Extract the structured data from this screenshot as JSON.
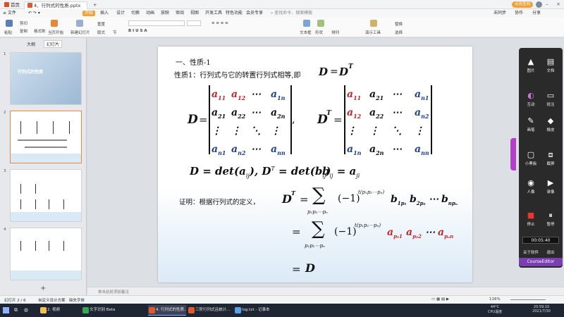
{
  "titlebar": {
    "tabs": [
      {
        "label": "首页",
        "icon": "home-icon"
      },
      {
        "label": "4、行列式的性质.pptx",
        "icon": "pptx-file-icon"
      }
    ],
    "add_tab": "+",
    "right_badge": "点亮签到"
  },
  "menubar": {
    "file": "≡ 文件",
    "items": [
      "开始",
      "插入",
      "设计",
      "切换",
      "动画",
      "放映",
      "审阅",
      "视图",
      "开发工具",
      "特色功能",
      "会员专享"
    ],
    "search_placeholder": "查找命令、搜索模板",
    "right": [
      "未同步",
      "协作",
      "分享"
    ]
  },
  "ribbon": {
    "groups": [
      "粘贴",
      "剪切",
      "复制",
      "格式刷",
      "当页开始",
      "新建幻灯片",
      "版式",
      "重置",
      "节",
      "文本框",
      "形状",
      "排列",
      "演示工具",
      "替换",
      "选择"
    ]
  },
  "leftpanel": {
    "tabs": [
      "大纲",
      "幻灯片"
    ],
    "slides": [
      {
        "num": "1",
        "title": "行列式的性质"
      },
      {
        "num": "2",
        "title": ""
      },
      {
        "num": "3",
        "title": ""
      },
      {
        "num": "4",
        "title": ""
      }
    ],
    "add": "+"
  },
  "slide": {
    "heading": "一、性质-1",
    "property_text": "性质1：行列式与它的转置行列式相等,即",
    "eq1_lhs": "D",
    "eq1_eq": "=",
    "eq1_rhs": "D",
    "eq1_sup": "T",
    "matrixD": {
      "label": "D",
      "eq": "=",
      "rows": [
        [
          {
            "b": "a",
            "s": "11",
            "c": "red"
          },
          {
            "b": "a",
            "s": "12",
            "c": "red"
          },
          {
            "b": "⋯",
            "s": "",
            "c": "blk"
          },
          {
            "b": "a",
            "s": "1n",
            "c": "blue"
          }
        ],
        [
          {
            "b": "a",
            "s": "21",
            "c": "blk"
          },
          {
            "b": "a",
            "s": "22",
            "c": "blk"
          },
          {
            "b": "⋯",
            "s": "",
            "c": "blk"
          },
          {
            "b": "a",
            "s": "2n",
            "c": "blk"
          }
        ],
        [
          {
            "b": "⋮",
            "s": "",
            "c": "blk"
          },
          {
            "b": "⋮",
            "s": "",
            "c": "blk"
          },
          {
            "b": "⋱",
            "s": "",
            "c": "blk"
          },
          {
            "b": "⋮",
            "s": "",
            "c": "blk"
          }
        ],
        [
          {
            "b": "a",
            "s": "n1",
            "c": "blue"
          },
          {
            "b": "a",
            "s": "n2",
            "c": "blue"
          },
          {
            "b": "⋯",
            "s": "",
            "c": "blk"
          },
          {
            "b": "a",
            "s": "nn",
            "c": "blue"
          }
        ]
      ],
      "comma": ","
    },
    "matrixDT": {
      "label": "D",
      "sup": "T",
      "eq": "=",
      "rows": [
        [
          {
            "b": "a",
            "s": "11",
            "c": "red"
          },
          {
            "b": "a",
            "s": "21",
            "c": "blk"
          },
          {
            "b": "⋯",
            "s": "",
            "c": "blk"
          },
          {
            "b": "a",
            "s": "n1",
            "c": "blue"
          }
        ],
        [
          {
            "b": "a",
            "s": "12",
            "c": "red"
          },
          {
            "b": "a",
            "s": "22",
            "c": "blk"
          },
          {
            "b": "⋯",
            "s": "",
            "c": "blk"
          },
          {
            "b": "a",
            "s": "n2",
            "c": "blue"
          }
        ],
        [
          {
            "b": "⋮",
            "s": "",
            "c": "blk"
          },
          {
            "b": "⋮",
            "s": "",
            "c": "blk"
          },
          {
            "b": "⋱",
            "s": "",
            "c": "blk"
          },
          {
            "b": "⋮",
            "s": "",
            "c": "blk"
          }
        ],
        [
          {
            "b": "a",
            "s": "1n",
            "c": "blue"
          },
          {
            "b": "a",
            "s": "2n",
            "c": "blk"
          },
          {
            "b": "⋯",
            "s": "",
            "c": "blk"
          },
          {
            "b": "a",
            "s": "nn",
            "c": "blue"
          }
        ]
      ]
    },
    "det_line": {
      "p1": "D = det(a",
      "p1sub": "ij",
      "p2": "),  D",
      "p2sup": "T",
      "p3": " = det(b",
      "p3sub": "ij",
      "p4": ")",
      "b": "b",
      "bsub": "ij",
      "beq": " = a",
      "asub": "ji"
    },
    "proof_label": "证明：根据行列式的定义，",
    "proof_lhs": "D",
    "proof_lhs_sup": "T",
    "proof_eq": "=",
    "sum": "∑",
    "sum_index": "p₁p₂⋯pₙ",
    "sign": "(−1)",
    "sign_exp": "t(p₁p₂⋯pₙ)",
    "prod1": [
      {
        "b": "b",
        "s": "1p₁"
      },
      {
        "b": "b",
        "s": "2p₂"
      },
      {
        "b": "⋯",
        "s": ""
      },
      {
        "b": "b",
        "s": "npₙ"
      }
    ],
    "prod2": [
      {
        "b": "a",
        "s": "p₁1"
      },
      {
        "b": "a",
        "s": "p₂2"
      },
      {
        "b": "⋯",
        "s": ""
      },
      {
        "b": "a",
        "s": "pₙn"
      }
    ],
    "final_eq": "=",
    "final_D": "D"
  },
  "tools": {
    "items": [
      "图片",
      "文档",
      "互动",
      "批注",
      "画笔",
      "橡皮",
      "小黑板",
      "截屏",
      "人像",
      "录像",
      "停止",
      "暂停"
    ],
    "timer": "00:05:40",
    "bottom": [
      "关于软件",
      "退出"
    ],
    "brand": "CourseEditor"
  },
  "notes": {
    "placeholder": "单击此处添加备注"
  },
  "status": {
    "slide_info": "幻灯片 2 / 6",
    "theme": "自定义设计方案",
    "missing_font": "缺失字体",
    "zoom": "116%"
  },
  "taskbar": {
    "items": [
      {
        "label": "2. 视频",
        "color": "#f2c14e"
      },
      {
        "label": "文字识别 Beta",
        "color": "#3aa757"
      },
      {
        "label": "4. 行列式的性质...",
        "color": "#e0582d"
      },
      {
        "label": "三阶行列式且统计...",
        "color": "#e0582d"
      },
      {
        "label": "log.txt - 记事本",
        "color": "#5da0e6"
      }
    ],
    "temp": "44°C",
    "temp_label": "CPU温度",
    "time": "20:59:10",
    "date": "2021/7/30"
  },
  "colors": {
    "accent_orange": "#f0a23b",
    "matrix_red": "#c0262c",
    "matrix_blue": "#1f3f8f",
    "tool_panel": "#2a2a2a",
    "brand_purple": "#7a3fb0"
  }
}
